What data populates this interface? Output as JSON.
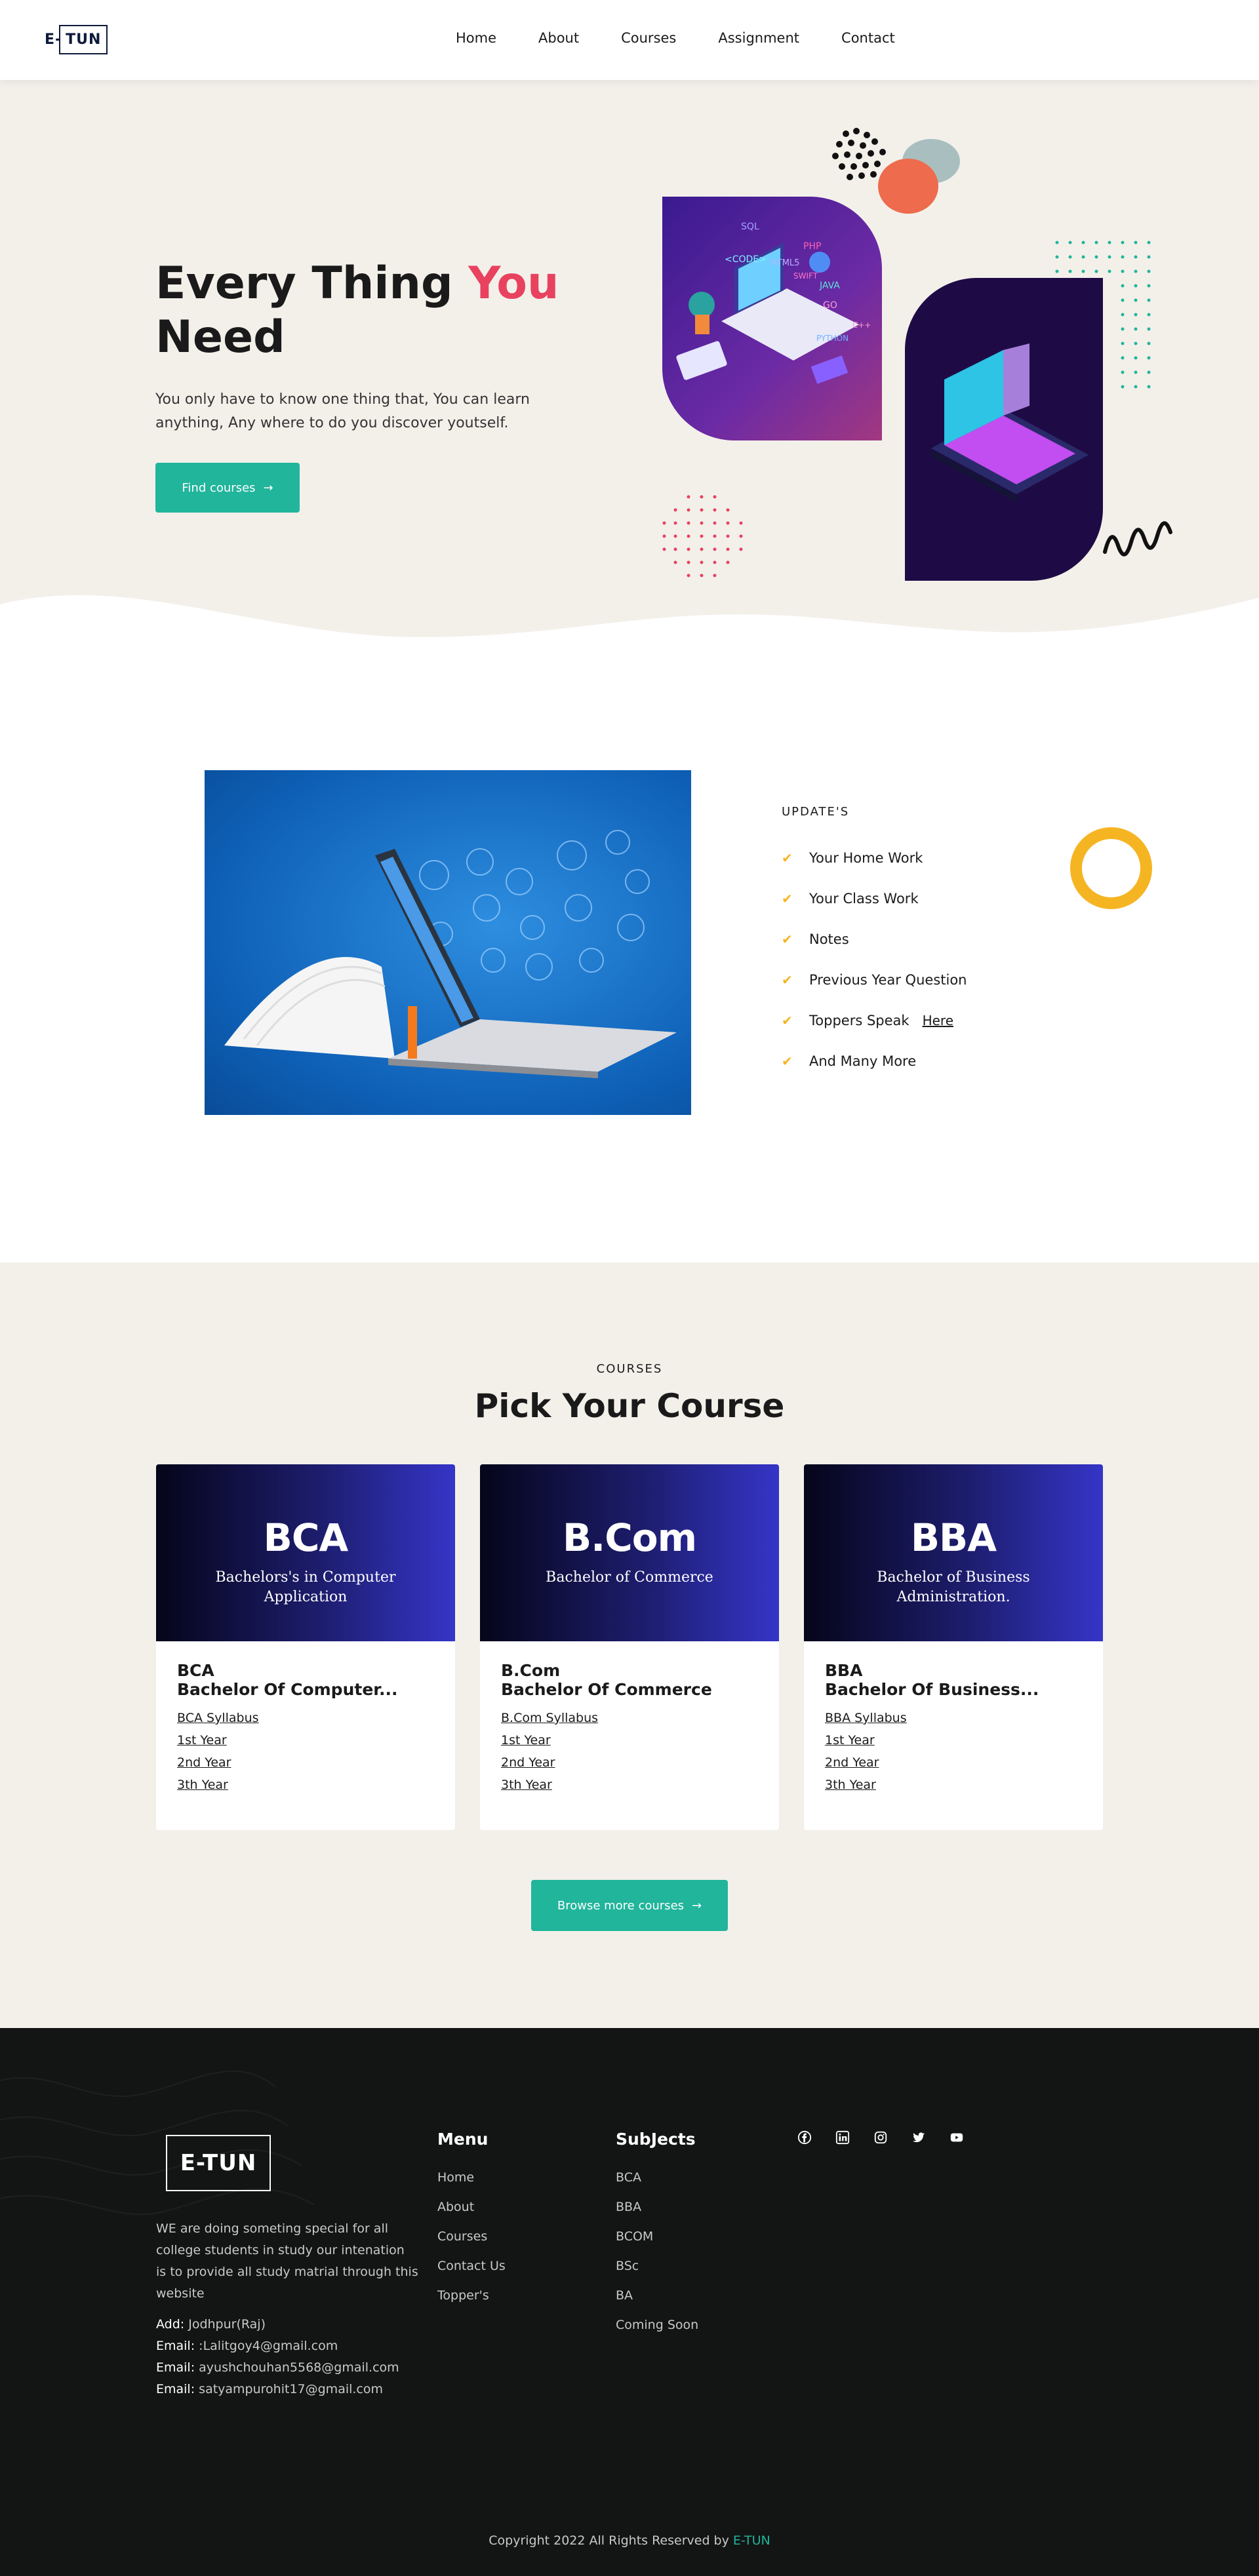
{
  "header": {
    "logo_text": "E-TUN",
    "logo_prefix": "E-",
    "logo_box": "TUN",
    "nav": [
      "Home",
      "About",
      "Courses",
      "Assignment",
      "Contact"
    ]
  },
  "hero": {
    "title_part1": "Every Thing ",
    "title_accent": "You",
    "title_part2": "Need",
    "lead": "You only have to know one thing that, You can learn anything, Any where to do you discover youtself.",
    "cta_label": "Find courses",
    "cta_icon": "arrow-right-icon",
    "illustration_words": [
      "SQL",
      "PHP",
      "HTML5",
      "JAVA",
      "GO",
      "<CODE>",
      "SWIFT",
      "PYTHON",
      "C++"
    ],
    "accent_color": "#e8425f"
  },
  "updates": {
    "title": "UPDATE'S",
    "items": [
      {
        "label": "Your Home Work"
      },
      {
        "label": "Your Class Work"
      },
      {
        "label": "Notes"
      },
      {
        "label": "Previous Year Question"
      },
      {
        "label": "Toppers Speak",
        "link": "Here"
      },
      {
        "label": "And Many More"
      }
    ],
    "check_color": "#f5b522"
  },
  "courses": {
    "eyebrow": "COURSES",
    "title": "Pick Your Course",
    "cards": [
      {
        "banner_big": "BCA",
        "banner_sub": "Bachelors's in Computer Application",
        "code": "BCA",
        "full": "Bachelor Of Computer...",
        "links": [
          "BCA Syllabus",
          "1st Year",
          "2nd Year",
          "3th Year"
        ]
      },
      {
        "banner_big": "B.Com",
        "banner_sub": "Bachelor of Commerce",
        "code": "B.Com",
        "full": "Bachelor Of Commerce",
        "links": [
          "B.Com Syllabus",
          "1st Year",
          "2nd Year",
          "3th Year"
        ]
      },
      {
        "banner_big": "BBA",
        "banner_sub": "Bachelor of Business Administration.",
        "code": "BBA",
        "full": "Bachelor Of Business...",
        "links": [
          "BBA Syllabus",
          "1st Year",
          "2nd Year",
          "3th Year"
        ]
      }
    ],
    "browse_label": "Browse more courses",
    "button_color": "#21b59c"
  },
  "footer": {
    "logo": "E-TUN",
    "about": "WE are doing someting special for all college students in study our intenation is to provide all study matrial through this website",
    "contacts": [
      {
        "label": "Add:",
        "value": " Jodhpur(Raj)"
      },
      {
        "label": "Email:",
        "value": " :Lalitgoy4@gmail.com"
      },
      {
        "label": "Email:",
        "value": " ayushchouhan5568@gmail.com"
      },
      {
        "label": "Email:",
        "value": " satyampurohit17@gmail.com"
      }
    ],
    "menu_title": "Menu",
    "menu": [
      "Home",
      "About",
      "Courses",
      "Contact Us",
      "Topper's"
    ],
    "subjects_title": "SubJects",
    "subjects": [
      "BCA",
      "BBA",
      "BCOM",
      "BSc",
      "BA",
      "Coming Soon"
    ],
    "social": [
      "facebook-icon",
      "linkedin-icon",
      "instagram-icon",
      "twitter-icon",
      "youtube-icon"
    ],
    "copyright": "Copyright 2022 All Rights Reserved by ",
    "copyright_brand": "E-TUN"
  }
}
